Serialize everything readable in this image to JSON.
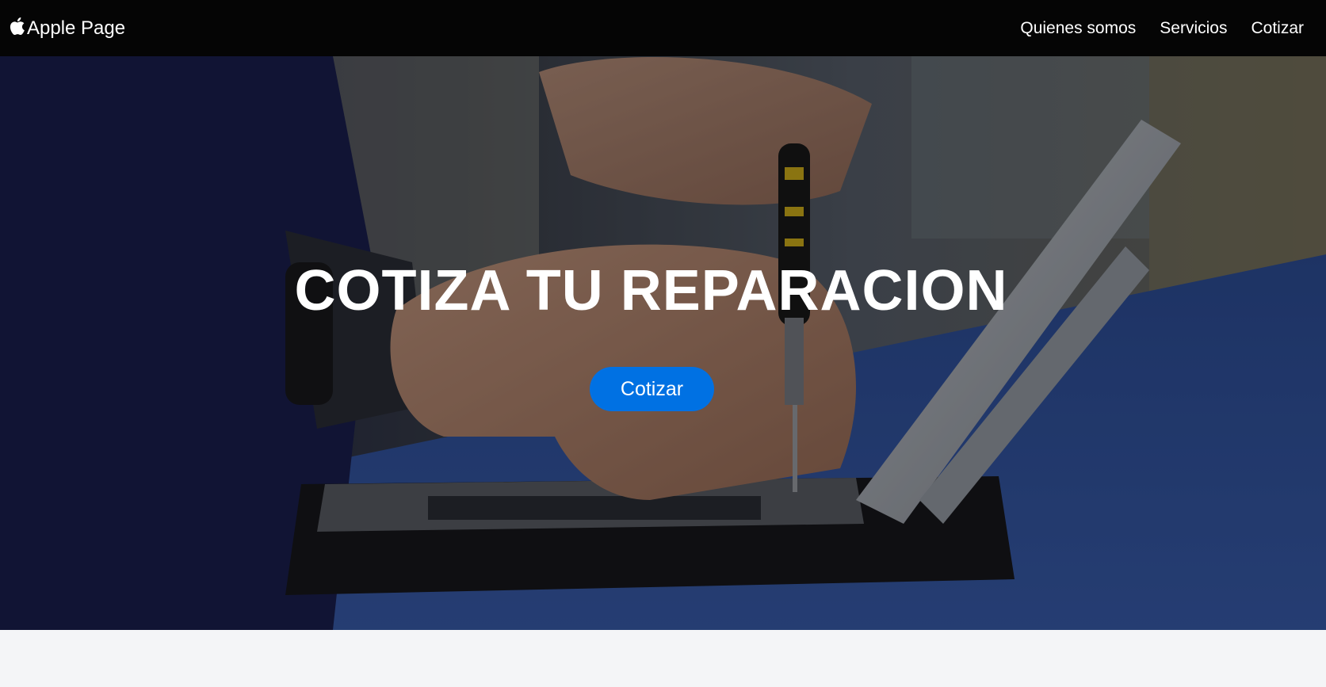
{
  "navbar": {
    "brand_icon": "apple-logo-icon",
    "brand_label": "Apple Page",
    "links": [
      {
        "label": "Quienes somos"
      },
      {
        "label": "Servicios"
      },
      {
        "label": "Cotizar"
      }
    ]
  },
  "hero": {
    "title": "COTIZA TU REPARACION",
    "button_label": "Cotizar"
  },
  "colors": {
    "navbar_bg": "#050505",
    "button_bg": "#0071e3",
    "page_bg": "#f4f5f7"
  }
}
